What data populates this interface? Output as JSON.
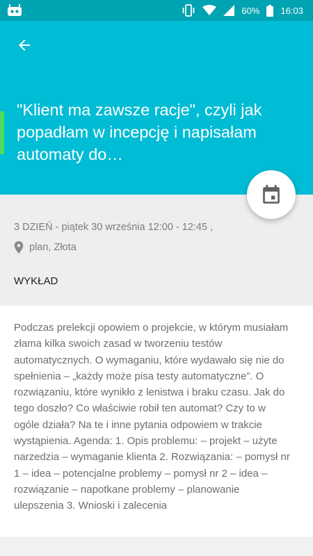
{
  "status_bar": {
    "app_icon": "android-debug-icon",
    "battery_percent": "60%",
    "time": "16:03",
    "icons": [
      "vibrate-icon",
      "wifi-icon",
      "cell-signal-icon",
      "battery-icon"
    ]
  },
  "header": {
    "back_icon": "arrow-back-icon",
    "title": "\"Klient ma zawsze racje\", czyli jak popadłam w incepcję i napisałam automaty do…",
    "background_color": "#00BCD4",
    "accent_color": "#4CDD5B"
  },
  "fab": {
    "icon": "calendar-icon"
  },
  "info": {
    "date_line": "3 DZIEŃ - piątek 30 września 12:00 - 12:45 ,",
    "location_icon": "location-pin-icon",
    "location": "plan, Złota",
    "type": "WYKŁAD"
  },
  "description": "Podczas prelekcji opowiem o projekcie, w którym musiałam złama kilka swoich zasad w tworzeniu testów automatycznych. O wymaganiu, które wydawało się nie do spełnienia – „każdy może pisa testy automatyczne”. O rozwiązaniu, które wynikło z lenistwa i braku czasu. Jak do tego doszło? Co właściwie robił ten automat? Czy to w ogóle działa? Na te i inne pytania odpowiem w trakcie wystąpienia. Agenda: 1. Opis problemu: – projekt – użyte narzedzia – wymaganie klienta 2. Rozwiązania: – pomysł nr 1 – idea – potencjalne problemy – pomysł nr 2 – idea – rozwiązanie – napotkane problemy – planowanie ulepszenia 3. Wnioski i zalecenia"
}
